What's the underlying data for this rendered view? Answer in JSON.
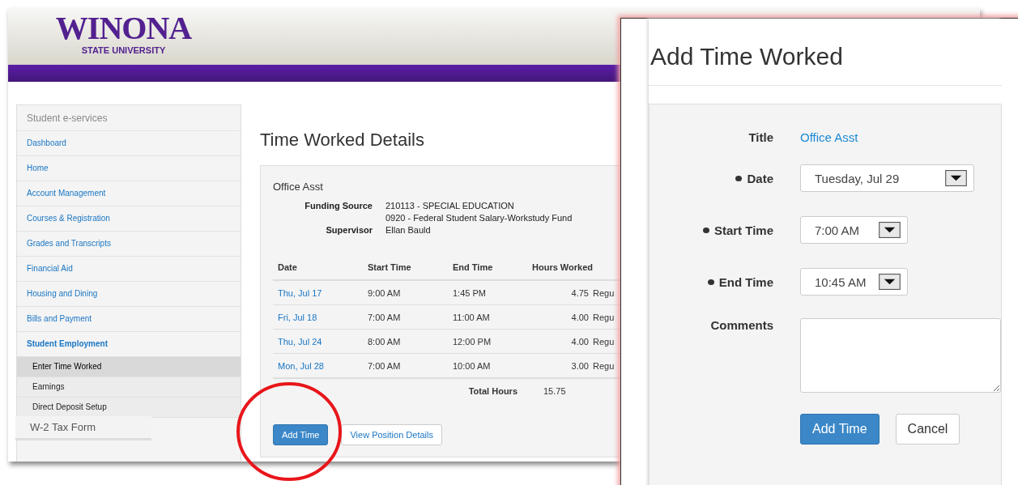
{
  "header": {
    "logo_name": "WINONA",
    "logo_sub": "STATE UNIVERSITY"
  },
  "sidebar": {
    "heading": "Student e-services",
    "items": [
      {
        "label": "Dashboard",
        "selected": false
      },
      {
        "label": "Home",
        "selected": false
      },
      {
        "label": "Account Management",
        "selected": false
      },
      {
        "label": "Courses & Registration",
        "selected": false
      },
      {
        "label": "Grades and Transcripts",
        "selected": false
      },
      {
        "label": "Financial Aid",
        "selected": false
      },
      {
        "label": "Housing and Dining",
        "selected": false
      },
      {
        "label": "Bills and Payment",
        "selected": false
      },
      {
        "label": "Student Employment",
        "selected": true,
        "children": [
          {
            "label": "Enter Time Worked",
            "selected": true
          },
          {
            "label": "Earnings",
            "selected": false
          },
          {
            "label": "Direct Deposit Setup",
            "selected": false
          }
        ]
      }
    ]
  },
  "callout": {
    "label": "W-2 Tax Form"
  },
  "page_title": "Time Worked Details",
  "position": {
    "title": "Office Asst",
    "details": [
      {
        "label": "Funding Source",
        "values": [
          "210113 - SPECIAL EDUCATION",
          "0920 - Federal Student Salary-Workstudy Fund"
        ]
      },
      {
        "label": "Supervisor",
        "values": [
          "Ellan Bauld"
        ]
      }
    ]
  },
  "table": {
    "columns": [
      "Date",
      "Start Time",
      "End Time",
      "Hours Worked"
    ],
    "rows": [
      {
        "date": "Thu, Jul 17",
        "start": "9:00 AM",
        "end": "1:45 PM",
        "hours": "4.75",
        "column_5": "Regu"
      },
      {
        "date": "Fri, Jul 18",
        "start": "7:00 AM",
        "end": "11:00 AM",
        "hours": "4.00",
        "column_5": "Regu"
      },
      {
        "date": "Thu, Jul 24",
        "start": "8:00 AM",
        "end": "12:00 PM",
        "hours": "4.00",
        "column_5": "Regu"
      },
      {
        "date": "Mon, Jul 28",
        "start": "7:00 AM",
        "end": "10:00 AM",
        "hours": "3.00",
        "column_5": "Regu"
      }
    ],
    "total_label": "Total Hours",
    "total": "15.75"
  },
  "buttons": [
    {
      "label": "Add Time",
      "kind": "primary"
    },
    {
      "label": "View Position Details",
      "kind": "default"
    }
  ],
  "annotation": {
    "kind": "circle"
  },
  "dialog": {
    "title": "Add Time Worked",
    "fields": [
      {
        "label": "Title",
        "kind": "text",
        "value": "Office Asst",
        "required": false
      },
      {
        "label": "Date",
        "kind": "date",
        "value": "Tuesday, Jul 29",
        "required": true
      },
      {
        "label": "Start Time",
        "kind": "time",
        "value": "7:00 AM",
        "required": true
      },
      {
        "label": "End Time",
        "kind": "time",
        "value": "10:45 AM",
        "required": true
      },
      {
        "label": "Comments",
        "kind": "textarea",
        "required": false
      }
    ],
    "buttons": [
      {
        "label": "Add Time",
        "kind": "primary"
      },
      {
        "label": "Cancel",
        "kind": "default"
      }
    ]
  }
}
